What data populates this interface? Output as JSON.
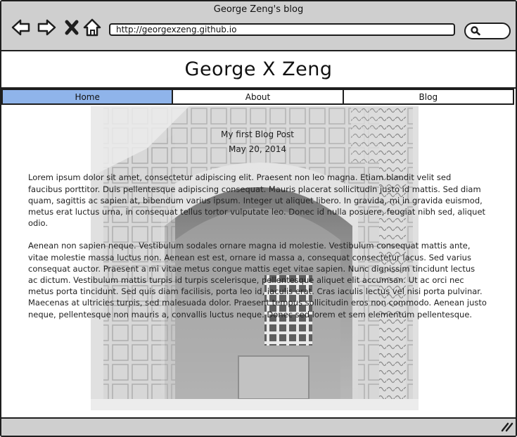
{
  "window": {
    "title": "George Zeng's blog",
    "url": "http://georgexzeng.github.io"
  },
  "header": {
    "site_title": "George X Zeng"
  },
  "nav": {
    "tabs": [
      {
        "label": "Home",
        "active": true
      },
      {
        "label": "About",
        "active": false
      },
      {
        "label": "Blog",
        "active": false
      }
    ]
  },
  "post": {
    "title": "My first Blog Post",
    "date": "May 20, 2014",
    "paragraphs": [
      "Lorem ipsum dolor sit amet, consectetur adipiscing elit. Praesent non leo magna. Etiam blandit velit sed faucibus porttitor. Duis pellentesque adipiscing consequat. Mauris placerat sollicitudin justo id mattis. Sed diam quam, sagittis ac sapien at, bibendum varius ipsum. Integer ut aliquet libero. In gravida, mi in gravida euismod, metus erat luctus urna, in consequat tellus tortor vulputate leo. Donec id nulla posuere, feugiat nibh sed, aliquet odio.",
      "Aenean non sapien neque. Vestibulum sodales ornare magna id molestie. Vestibulum consequat mattis ante, vitae molestie massa luctus non. Aenean est est, ornare id massa a, consequat consectetur lacus. Sed varius consequat auctor. Praesent a mi vitae metus congue mattis eget vitae sapien. Nunc dignissim tincidunt lectus ac dictum. Vestibulum mattis turpis id turpis scelerisque, pellentesque aliquet elit accumsan. Ut ac orci nec metus porta tincidunt. Sed quis diam facilisis, porta leo id, iaculis erat. Cras iaculis lectus vel nisi porta pulvinar. Maecenas at ultricies turpis, sed malesuada dolor. Praesent tempus sollicitudin eros non commodo. Aenean justo neque, pellentesque non mauris a, convallis luctus neque. Donec sed lorem et sem elementum pellentesque."
    ]
  },
  "colors": {
    "active_tab": "#8fb4ea",
    "chrome": "#cfcfcf",
    "border": "#1e1e1e"
  },
  "icons": [
    "back-arrow-icon",
    "forward-arrow-icon",
    "close-icon",
    "home-icon",
    "search-icon",
    "resize-grip-icon"
  ]
}
